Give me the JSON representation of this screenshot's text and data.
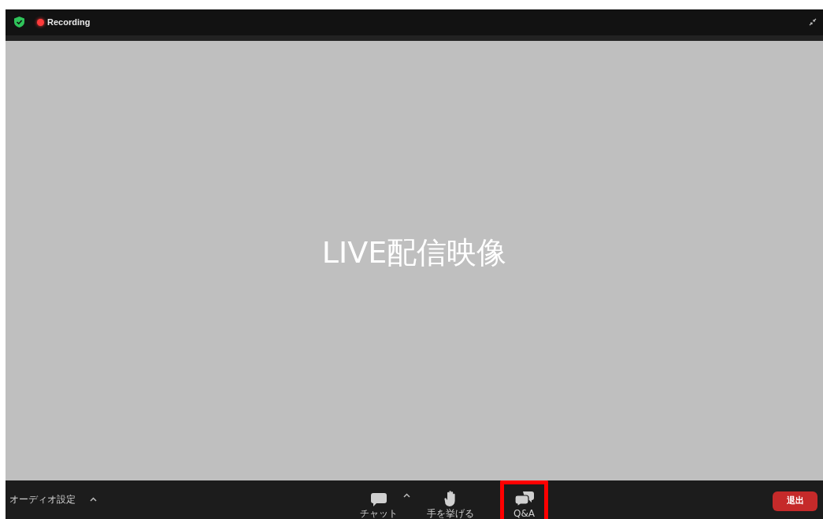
{
  "top_bar": {
    "recording_label": "Recording"
  },
  "video": {
    "placeholder_text": "LIVE配信映像"
  },
  "toolbar": {
    "audio_settings": "オーディオ設定",
    "items": [
      {
        "kind": "chat",
        "label": "チャット",
        "highlighted": false
      },
      {
        "kind": "hand",
        "label": "手を挙げる",
        "highlighted": false
      },
      {
        "kind": "qa",
        "label": "Q&A",
        "highlighted": true
      }
    ],
    "leave_button": "退出"
  }
}
